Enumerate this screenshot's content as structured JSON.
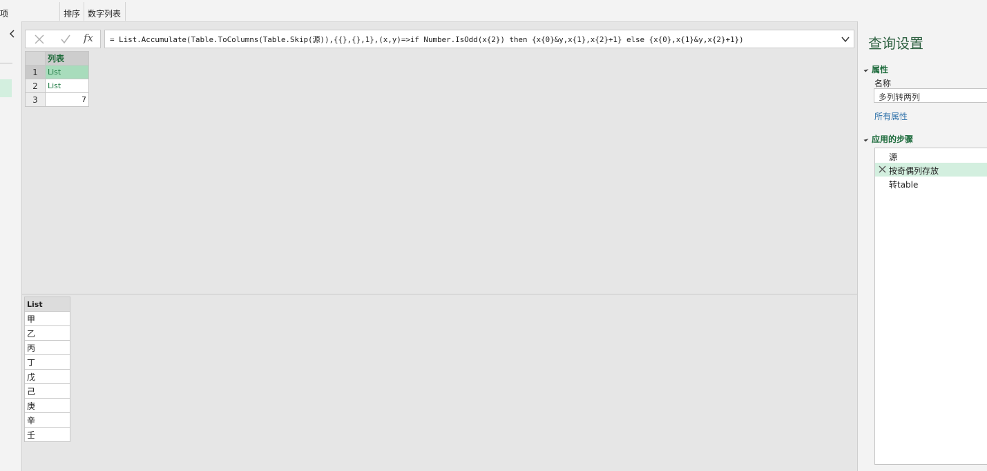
{
  "ribbon": {
    "items": [
      {
        "label": "项"
      },
      {
        "label": "排序"
      },
      {
        "label": "数字列表"
      }
    ]
  },
  "formula_bar": {
    "cancel_icon": "close-icon",
    "confirm_icon": "check-icon",
    "fx_label": "fx",
    "formula": "= List.Accumulate(Table.ToColumns(Table.Skip(源)),{{},{},1},(x,y)=>if Number.IsOdd(x{2}) then {x{0}&y,x{1},x{2}+1} else {x{0},x{1}&y,x{2}+1})"
  },
  "result_grid": {
    "column_header": "列表",
    "rows": [
      {
        "num": "1",
        "value": "List"
      },
      {
        "num": "2",
        "value": "List"
      },
      {
        "num": "3",
        "value": "7"
      }
    ]
  },
  "preview": {
    "header": "List",
    "items": [
      "甲",
      "乙",
      "丙",
      "丁",
      "戊",
      "己",
      "庚",
      "辛",
      "壬"
    ]
  },
  "query_settings": {
    "title": "查询设置",
    "properties_section": "属性",
    "name_label": "名称",
    "name_value": "多列转两列",
    "all_properties_link": "所有属性",
    "steps_section": "应用的步骤",
    "steps": [
      {
        "label": "源"
      },
      {
        "label": "按奇偶列存放"
      },
      {
        "label": "转table"
      }
    ]
  },
  "colors": {
    "accent_green": "#1e6b3a",
    "selected_green": "#a8dcbc",
    "selected_step": "#d3efdf",
    "link_blue": "#2a6ea8"
  }
}
